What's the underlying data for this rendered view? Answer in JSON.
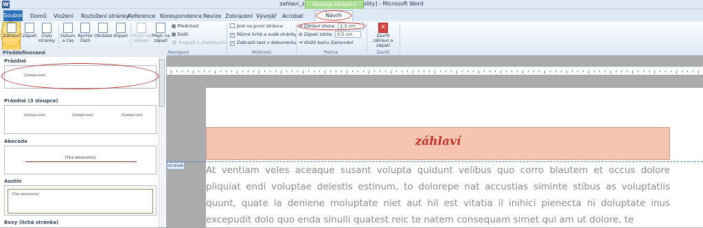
{
  "window": {
    "title": "zahlavi_zapati [režim kompatibility] - Microsoft Word",
    "app_icon": "W"
  },
  "context_tab_group": "Nástroje záhlaví a zápatí",
  "tabs": {
    "file": "Soubor",
    "items": [
      "Domů",
      "Vložení",
      "Rozložení stránky",
      "Reference",
      "Korespondence",
      "Revize",
      "Zobrazení",
      "Vývojář",
      "Acrobat"
    ],
    "design": "Návrh"
  },
  "ribbon": {
    "header_footer": {
      "header": "Záhlaví",
      "footer": "Zápatí",
      "page_number": "Číslo stránky"
    },
    "insert": {
      "date_time": "Datum a čas",
      "quick_parts": "Rychlé části",
      "picture": "Obrázek",
      "clipart": "Klipart"
    },
    "navigation": {
      "goto_header": "Přejít na záhlaví",
      "goto_footer": "Přejít na zápatí",
      "previous": "Předchozí",
      "next": "Další",
      "link_previous": "Propojit s předchozím",
      "label": "Navigace"
    },
    "options": {
      "different_first": "Jiné na první stránce",
      "different_odd_even": "Různé liché a sudé stránky",
      "show_text": "Zobrazit text v dokumentu",
      "label": "Možnosti"
    },
    "position": {
      "header_top_label": "Záhlaví shora:",
      "header_top_value": "1,3 cm",
      "footer_bottom_label": "Zápatí zdola:",
      "footer_bottom_value": "0,5 cm",
      "insert_align_tab": "Vložit kartu Zarovnání",
      "label": "Pozice"
    },
    "close": {
      "close_label": "Zavřít záhlaví a zápatí",
      "label": "Zavřít"
    }
  },
  "gallery": {
    "header": "Předdefinované",
    "sections": [
      {
        "name": "Prázdné",
        "placeholders": [
          "[Zadejte text]"
        ]
      },
      {
        "name": "Prázdné (3 sloupce)",
        "placeholders": [
          "[Zadejte text]",
          "[Zadejte text]",
          "[Zadejte text]"
        ]
      },
      {
        "name": "Abeceda",
        "placeholders": [
          "[Titul dokumentu]"
        ]
      },
      {
        "name": "Austin",
        "placeholders": [
          "[Titul dokumentu]"
        ]
      },
      {
        "name": "Boxy (lichá stránka)",
        "placeholders": []
      }
    ]
  },
  "document": {
    "header_text": "záhlaví",
    "header_tag": "stránek",
    "body": "At ventiam veles aceaque susant volupta quidunt velibus quo corro blautem et occus dolore pliquiat endi voluptae delestis estinum, to dolorepe nat accustias siminte stibus as voluptatiis quunt, quate la deniene moluptate niet aut hil est vitatia il inihici pienecta ni doluptate inus excepudit dolo quo enda sinulli quatest reic te natem consequam simet qui am ut dolore, te"
  },
  "colors": {
    "accent": "#2a6fb8",
    "header_fill": "#f7c4b0",
    "header_text": "#c0342a",
    "annotation": "#c8302a",
    "context_green": "#8ed174"
  }
}
